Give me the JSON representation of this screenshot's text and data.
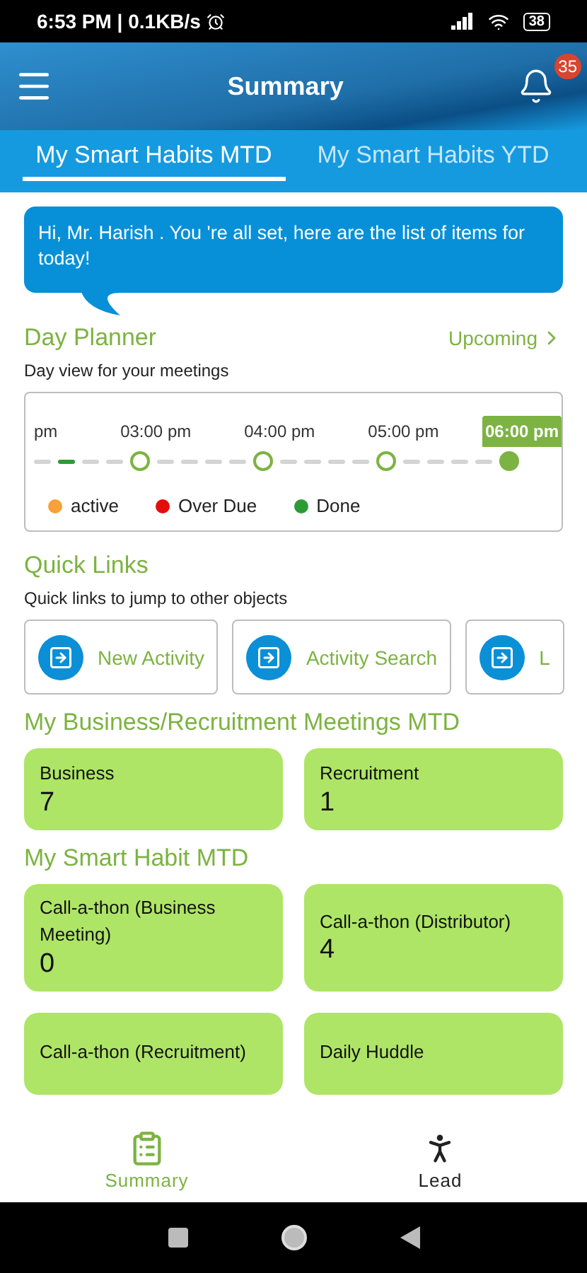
{
  "status_bar": {
    "time": "6:53 PM | 0.1KB/s",
    "battery": "38"
  },
  "header": {
    "title": "Summary",
    "notifications": "35"
  },
  "tabs": [
    {
      "label": "My Smart Habits MTD",
      "selected": true
    },
    {
      "label": "My Smart Habits YTD",
      "selected": false
    }
  ],
  "greeting": "Hi, Mr. Harish . You 're all set, here are the list of items for today!",
  "day_planner": {
    "title": "Day Planner",
    "link": "Upcoming",
    "subtitle": "Day view for your meetings",
    "times": [
      {
        "label": "pm",
        "selected": false
      },
      {
        "label": "03:00 pm",
        "selected": false
      },
      {
        "label": "04:00 pm",
        "selected": false
      },
      {
        "label": "05:00 pm",
        "selected": false
      },
      {
        "label": "06:00 pm",
        "selected": true
      }
    ],
    "track": [
      {
        "kind": "dash"
      },
      {
        "kind": "dash-done"
      },
      {
        "kind": "dash"
      },
      {
        "kind": "dash"
      },
      {
        "kind": "ring"
      },
      {
        "kind": "dash"
      },
      {
        "kind": "dash"
      },
      {
        "kind": "dash"
      },
      {
        "kind": "dash"
      },
      {
        "kind": "ring"
      },
      {
        "kind": "dash"
      },
      {
        "kind": "dash"
      },
      {
        "kind": "dash"
      },
      {
        "kind": "dash"
      },
      {
        "kind": "ring"
      },
      {
        "kind": "dash"
      },
      {
        "kind": "dash"
      },
      {
        "kind": "dash"
      },
      {
        "kind": "dash"
      },
      {
        "kind": "dot"
      }
    ],
    "legend": [
      {
        "label": "active",
        "color": "#f7a13a"
      },
      {
        "label": "Over Due",
        "color": "#e30d0d"
      },
      {
        "label": "Done",
        "color": "#2e9a36"
      }
    ]
  },
  "quick_links": {
    "title": "Quick Links",
    "subtitle": "Quick links to jump to other objects",
    "items": [
      {
        "label": "New Activity"
      },
      {
        "label": "Activity Search"
      },
      {
        "label": "L"
      }
    ]
  },
  "meetings": {
    "title": "My Business/Recruitment Meetings MTD",
    "tiles": [
      {
        "label": "Business",
        "value": "7"
      },
      {
        "label": "Recruitment",
        "value": "1"
      }
    ]
  },
  "habits": {
    "title": "My Smart Habit MTD",
    "tiles": [
      {
        "label": "Call-a-thon (Business Meeting)",
        "value": "0"
      },
      {
        "label": "Call-a-thon (Distributor)",
        "value": "4"
      },
      {
        "label": "Call-a-thon (Recruitment)"
      },
      {
        "label": "Daily Huddle"
      }
    ]
  },
  "bottom_nav": [
    {
      "label": "Summary",
      "kind": "summary",
      "selected": true
    },
    {
      "label": "Lead",
      "kind": "lead",
      "selected": false
    }
  ]
}
